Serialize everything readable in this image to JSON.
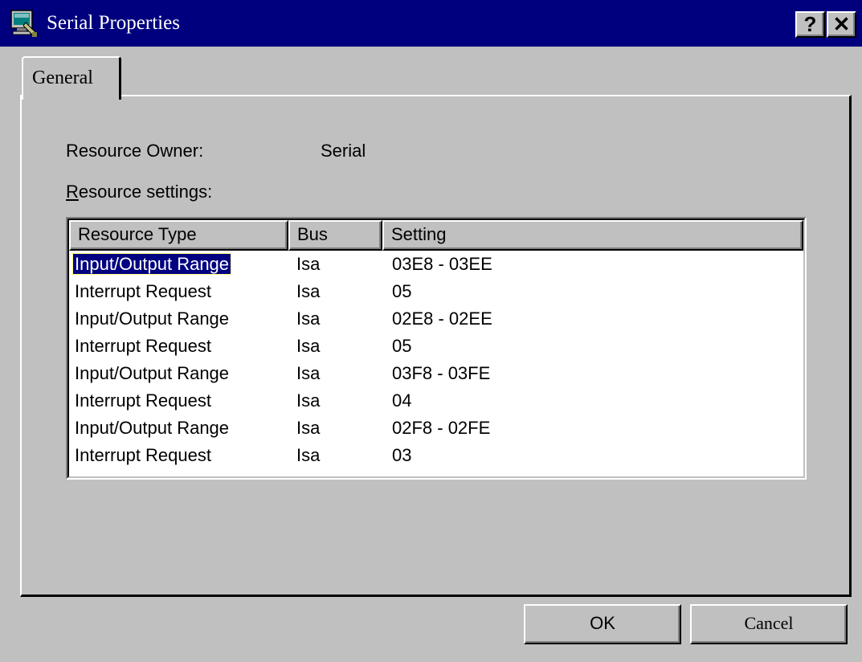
{
  "window": {
    "title": "Serial Properties",
    "help_glyph": "?",
    "close_glyph": "✕",
    "icon": "device-properties-icon"
  },
  "tabs": [
    {
      "label": "General",
      "active": true
    }
  ],
  "general": {
    "owner_label": "Resource Owner:",
    "owner_value": "Serial",
    "settings_label_accel": "R",
    "settings_label_rest": "esource settings:"
  },
  "resource_list": {
    "columns": [
      "Resource Type",
      "Bus",
      "Setting"
    ],
    "rows": [
      {
        "type": "Input/Output Range",
        "bus": "Isa",
        "setting": "03E8 - 03EE"
      },
      {
        "type": "Interrupt Request",
        "bus": "Isa",
        "setting": "05"
      },
      {
        "type": "Input/Output Range",
        "bus": "Isa",
        "setting": "02E8 - 02EE"
      },
      {
        "type": "Interrupt Request",
        "bus": "Isa",
        "setting": "05"
      },
      {
        "type": "Input/Output Range",
        "bus": "Isa",
        "setting": "03F8 - 03FE"
      },
      {
        "type": "Interrupt Request",
        "bus": "Isa",
        "setting": "04"
      },
      {
        "type": "Input/Output Range",
        "bus": "Isa",
        "setting": "02F8 - 02FE"
      },
      {
        "type": "Interrupt Request",
        "bus": "Isa",
        "setting": "03"
      }
    ],
    "selected_row": 0
  },
  "buttons": {
    "ok": "OK",
    "cancel": "Cancel"
  },
  "colors": {
    "titlebar": "#00007f",
    "face": "#c0c0c0",
    "selection": "#000080"
  }
}
